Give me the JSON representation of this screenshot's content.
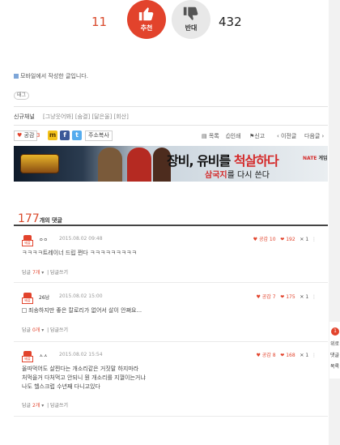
{
  "vote": {
    "up_count": "11",
    "up_label": "추천",
    "down_label": "반대",
    "down_count": "432"
  },
  "post": {
    "mobile_note": "모바일에서 작성한 글입니다.",
    "tag_label": "태그"
  },
  "channel": {
    "label": "신규채널",
    "links": "[그냥웃어봐] [숨결] [달은울] [회산]"
  },
  "toolbar": {
    "like_label": "공감",
    "like_count": "3",
    "copy_label": "주소복사",
    "list_label": "목록",
    "print_label": "인쇄",
    "report_label": "신고",
    "prev_label": "이전글",
    "next_label": "다음글"
  },
  "banner": {
    "headline_a": "장비, 유비를 ",
    "headline_b": "척살하다",
    "sub_a": "삼국지",
    "sub_b": "를 다시 쓴다",
    "brand": "NATE",
    "brand_suffix": "게임"
  },
  "comments_header": {
    "count": "177",
    "label": "개의 댓글"
  },
  "comments": [
    {
      "badge": "베플",
      "user": "ㅇㅇ",
      "level": "",
      "date": "2015.08.02 09:48",
      "like_label": "공감",
      "like_count": "10",
      "heart_count": "192",
      "dislike_count": "1",
      "lines": [
        "ㅋㅋㅋㅋ트레이너 드립 쩐다 ㅋㅋㅋㅋㅋㅋㅋㅋㅋ"
      ],
      "reply_label": "답글",
      "reply_count": "7개",
      "reply_write": "답글쓰기"
    },
    {
      "badge": "베플",
      "user": "26남",
      "level": "",
      "date": "2015.08.02 15:00",
      "like_label": "공감",
      "like_count": "7",
      "heart_count": "175",
      "dislike_count": "1",
      "lines": [
        "죄송하지만 좋은 칼로리가 없어서 살이 안쪄요..."
      ],
      "reply_label": "답글",
      "reply_count": "0개",
      "reply_write": "답글쓰기"
    },
    {
      "badge": "베플",
      "user": "ㅅㅅ",
      "level": "",
      "date": "2015.08.02 15:54",
      "like_label": "공감",
      "like_count": "8",
      "heart_count": "168",
      "dislike_count": "1",
      "lines": [
        "올따먹어도 살찐다는 개소리같은 거짓말 하지마라",
        "처먹을거 다처먹고 안되니 뭔 개소리를 지껄이는거냐",
        "나도 헬스크럽 수년째 다니고있다"
      ],
      "reply_label": "답글",
      "reply_count": "2개",
      "reply_write": "답글쓰기"
    }
  ],
  "side": {
    "top_label": "1",
    "items": [
      "위로",
      "댓글",
      "목록"
    ]
  },
  "colors": {
    "accent": "#e2432c",
    "text": "#333333",
    "muted": "#999999"
  }
}
